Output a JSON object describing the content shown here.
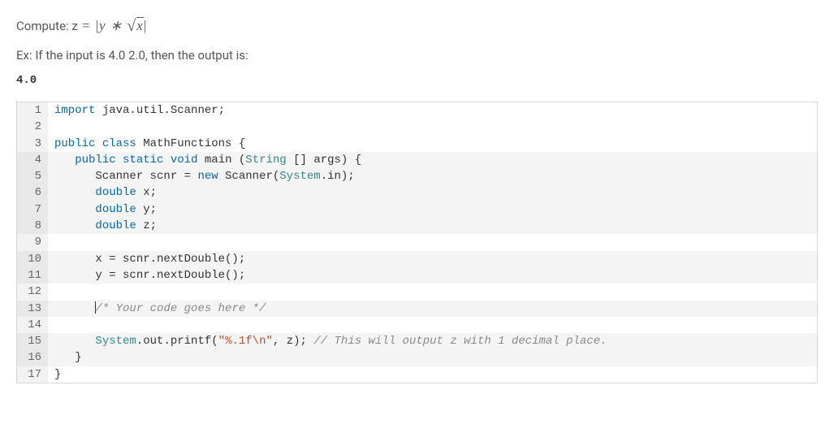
{
  "instruction_prefix": "Compute: z",
  "math_equals": " = ",
  "math_y": "y",
  "math_star": " ∗ ",
  "math_x": "x",
  "example_line": "Ex: If the input is 4.0 2.0, then the output is:",
  "example_output": "4.0",
  "code": {
    "lines": [
      {
        "num": 1,
        "tokens": [
          {
            "t": "import",
            "c": "kw"
          },
          {
            "t": " java.util.Scanner;"
          }
        ]
      },
      {
        "num": 2,
        "tokens": []
      },
      {
        "num": 3,
        "tokens": [
          {
            "t": "public",
            "c": "kw"
          },
          {
            "t": " "
          },
          {
            "t": "class",
            "c": "kw"
          },
          {
            "t": " MathFunctions {"
          }
        ]
      },
      {
        "num": 4,
        "hl": true,
        "tokens": [
          {
            "t": "   "
          },
          {
            "t": "public",
            "c": "kw"
          },
          {
            "t": " "
          },
          {
            "t": "static",
            "c": "kw"
          },
          {
            "t": " "
          },
          {
            "t": "void",
            "c": "kw"
          },
          {
            "t": " main ("
          },
          {
            "t": "String",
            "c": "type"
          },
          {
            "t": " [] args) {"
          }
        ]
      },
      {
        "num": 5,
        "hl": true,
        "tokens": [
          {
            "t": "      Scanner scnr = "
          },
          {
            "t": "new",
            "c": "kw"
          },
          {
            "t": " Scanner("
          },
          {
            "t": "System",
            "c": "type"
          },
          {
            "t": ".in);"
          }
        ]
      },
      {
        "num": 6,
        "hl": true,
        "tokens": [
          {
            "t": "      "
          },
          {
            "t": "double",
            "c": "kw"
          },
          {
            "t": " x;"
          }
        ]
      },
      {
        "num": 7,
        "hl": true,
        "tokens": [
          {
            "t": "      "
          },
          {
            "t": "double",
            "c": "kw"
          },
          {
            "t": " y;"
          }
        ]
      },
      {
        "num": 8,
        "hl": true,
        "tokens": [
          {
            "t": "      "
          },
          {
            "t": "double",
            "c": "kw"
          },
          {
            "t": " z;"
          }
        ]
      },
      {
        "num": 9,
        "tokens": []
      },
      {
        "num": 10,
        "hl": true,
        "tokens": [
          {
            "t": "      x = scnr.nextDouble();"
          }
        ]
      },
      {
        "num": 11,
        "hl": true,
        "tokens": [
          {
            "t": "      y = scnr.nextDouble();"
          }
        ]
      },
      {
        "num": 12,
        "tokens": []
      },
      {
        "num": 13,
        "hl": true,
        "editable": true,
        "tokens": [
          {
            "t": "      "
          },
          {
            "t": "/* Your code goes here */",
            "c": "comment"
          }
        ]
      },
      {
        "num": 14,
        "tokens": []
      },
      {
        "num": 15,
        "hl": true,
        "tokens": [
          {
            "t": "      "
          },
          {
            "t": "System",
            "c": "type"
          },
          {
            "t": ".out.printf("
          },
          {
            "t": "\"%.1f\\n\"",
            "c": "str"
          },
          {
            "t": ", z); "
          },
          {
            "t": "// This will output z with 1 decimal place.",
            "c": "comment"
          }
        ]
      },
      {
        "num": 16,
        "hl": true,
        "tokens": [
          {
            "t": "   }"
          }
        ]
      },
      {
        "num": 17,
        "tokens": [
          {
            "t": "}"
          }
        ]
      }
    ]
  }
}
